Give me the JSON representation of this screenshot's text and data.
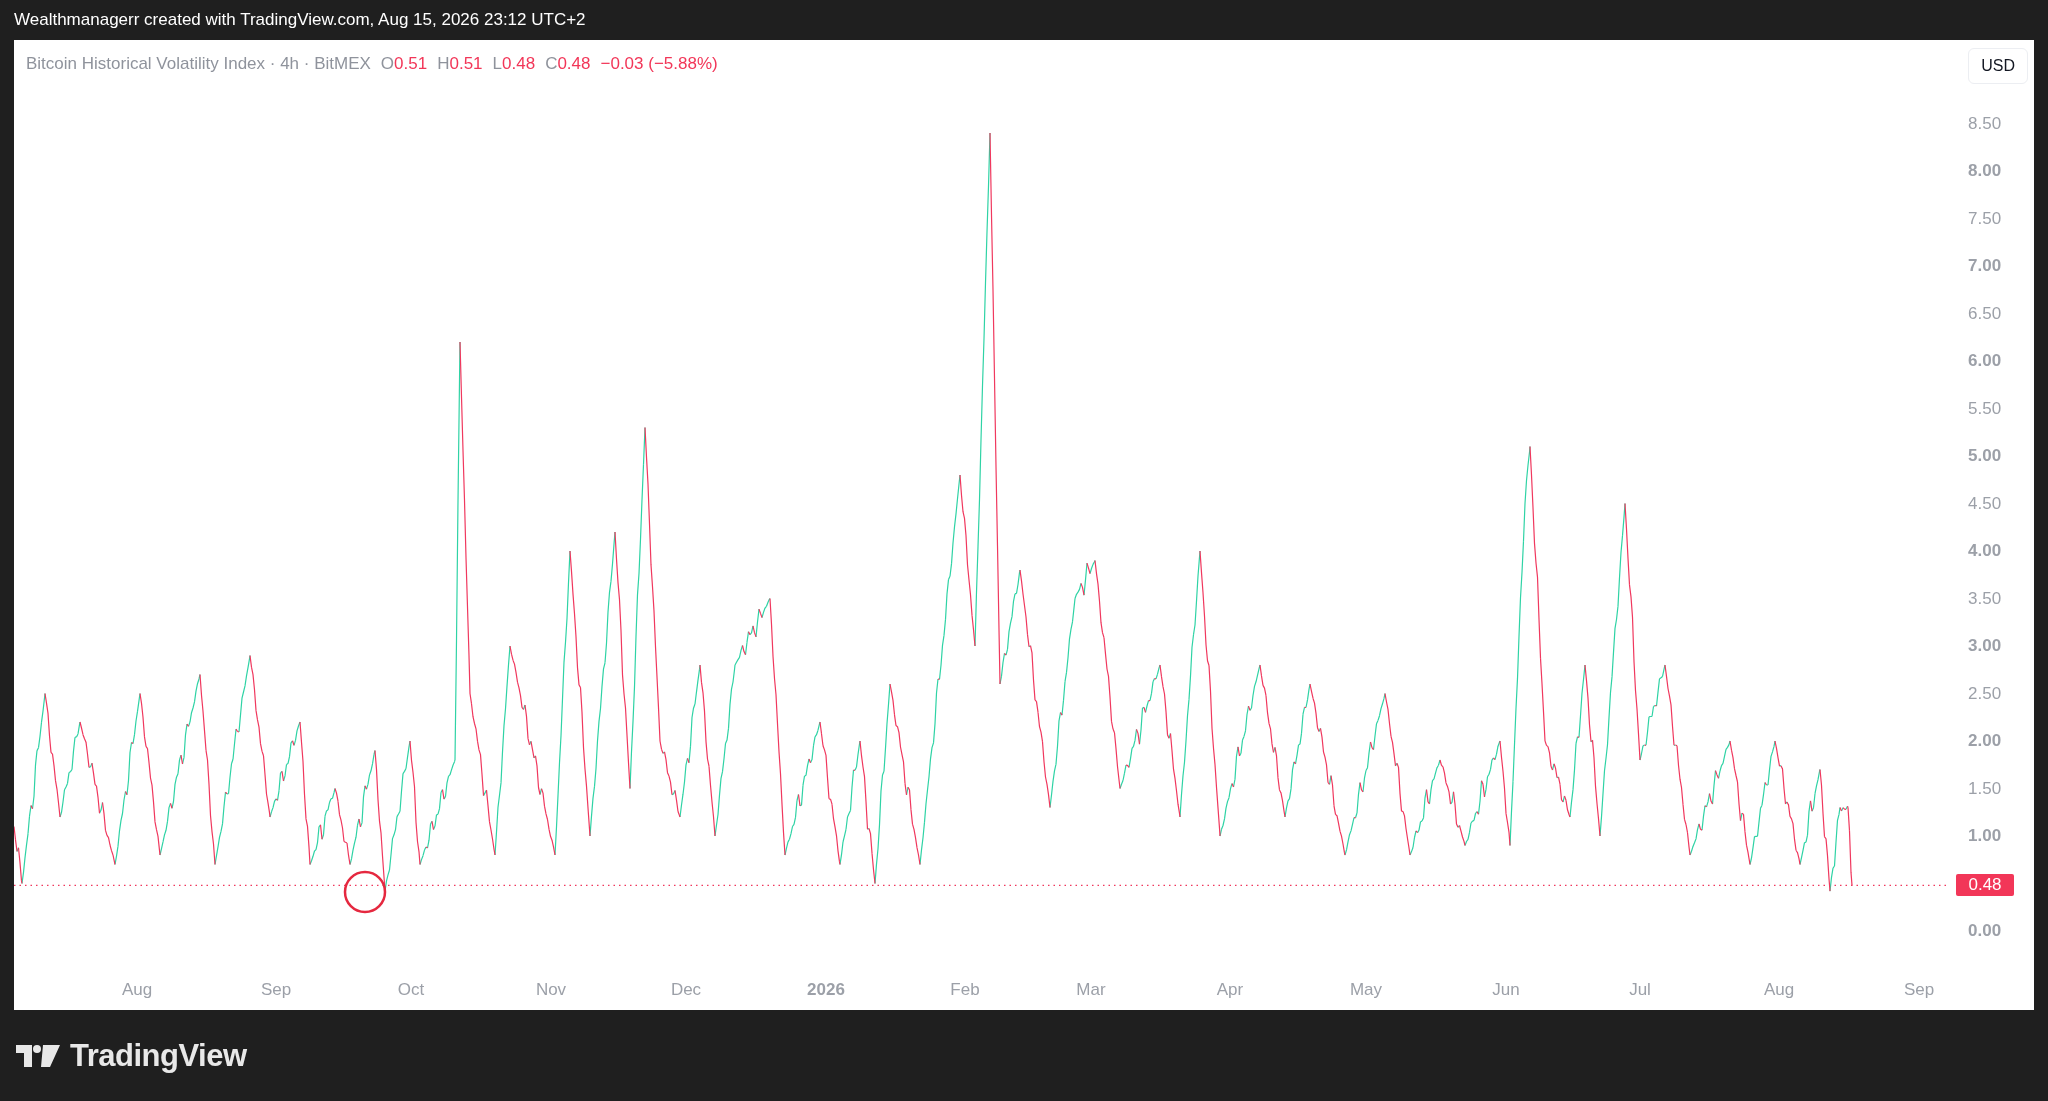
{
  "header": {
    "caption": "Wealthmanagerr created with TradingView.com, Aug 15, 2026 23:12 UTC+2"
  },
  "chart": {
    "legend": {
      "title": "Bitcoin Historical Volatility Index · 4h · BitMEX",
      "ohlc": [
        {
          "key": "O",
          "value": "0.51"
        },
        {
          "key": "H",
          "value": "0.51"
        },
        {
          "key": "L",
          "value": "0.48"
        },
        {
          "key": "C",
          "value": "0.48"
        }
      ],
      "change": "−0.03 (−5.88%)"
    },
    "currency_button": "USD",
    "price_axis": [
      "8.50",
      "8.00",
      "7.50",
      "7.00",
      "6.50",
      "6.00",
      "5.50",
      "5.00",
      "4.50",
      "4.00",
      "3.50",
      "3.00",
      "2.50",
      "2.00",
      "1.50",
      "1.00",
      "0.00"
    ],
    "last_price": "0.48",
    "time_axis": [
      {
        "label": "Aug",
        "kind": "month"
      },
      {
        "label": "Sep",
        "kind": "month"
      },
      {
        "label": "Oct",
        "kind": "month"
      },
      {
        "label": "Nov",
        "kind": "month"
      },
      {
        "label": "Dec",
        "kind": "month"
      },
      {
        "label": "2026",
        "kind": "year"
      },
      {
        "label": "Feb",
        "kind": "month"
      },
      {
        "label": "Mar",
        "kind": "month"
      },
      {
        "label": "Apr",
        "kind": "month"
      },
      {
        "label": "May",
        "kind": "month"
      },
      {
        "label": "Jun",
        "kind": "month"
      },
      {
        "label": "Jul",
        "kind": "month"
      },
      {
        "label": "Aug",
        "kind": "month"
      },
      {
        "label": "Sep",
        "kind": "month"
      }
    ]
  },
  "footer": {
    "brand": "TradingView"
  }
}
